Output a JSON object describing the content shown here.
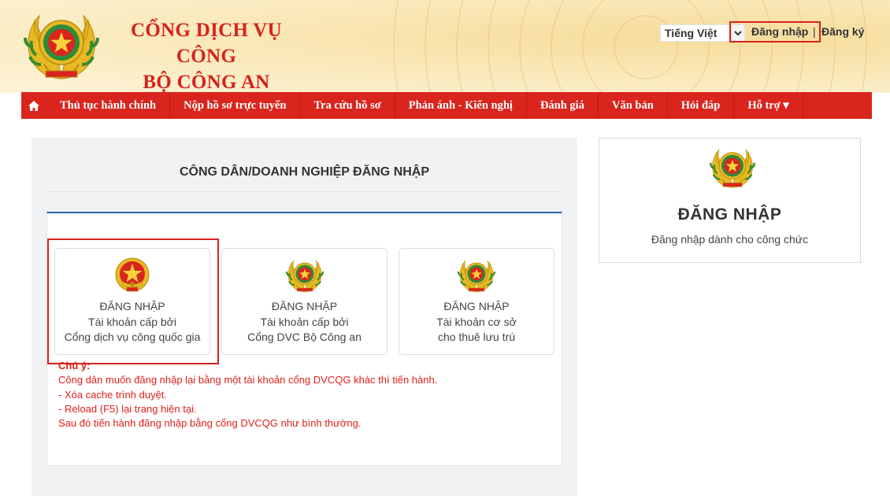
{
  "header": {
    "title_line1": "CỔNG DỊCH VỤ CÔNG",
    "title_line2": "BỘ CÔNG AN",
    "language": "Tiếng Việt",
    "login": "Đăng nhập",
    "separator": "|",
    "register": "Đăng ký"
  },
  "nav": {
    "home_icon": "home-icon",
    "items": [
      "Thủ tục hành chính",
      "Nộp hồ sơ trực tuyến",
      "Tra cứu hồ sơ",
      "Phản ánh - Kiến nghị",
      "Đánh giá",
      "Văn bản",
      "Hỏi đáp",
      "Hỗ trợ ▾"
    ]
  },
  "main": {
    "title": "CÔNG DÂN/DOANH NGHIỆP ĐĂNG NHẬP",
    "options": [
      {
        "line1": "ĐĂNG NHẬP",
        "line2": "Tài khoản cấp bởi",
        "line3": "Cổng dịch vụ công quốc gia",
        "icon": "national-emblem-icon"
      },
      {
        "line1": "ĐĂNG NHẬP",
        "line2": "Tài khoản cấp bởi",
        "line3": "Cổng DVC Bộ Công an",
        "icon": "police-emblem-icon"
      },
      {
        "line1": "ĐĂNG NHẬP",
        "line2": "Tài khoản cơ sở",
        "line3": "cho thuê lưu trú",
        "icon": "police-emblem-icon"
      }
    ],
    "note": {
      "heading": "Chú ý:",
      "lines": [
        "Công dân muốn đăng nhập lại bằng một tài khoản cổng DVCQG khác thì tiến hành.",
        "- Xóa cache trình duyệt.",
        "- Reload (F5) lại trang hiện tại.",
        "Sau đó tiến hành đăng nhập bằng cổng DVCQG như bình thường."
      ]
    }
  },
  "right": {
    "title": "ĐĂNG NHẬP",
    "subtitle": "Đăng nhập dành cho công chức"
  },
  "colors": {
    "brand_red": "#d9251d",
    "accent_blue": "#2962a8",
    "note_red": "#e0201a"
  }
}
